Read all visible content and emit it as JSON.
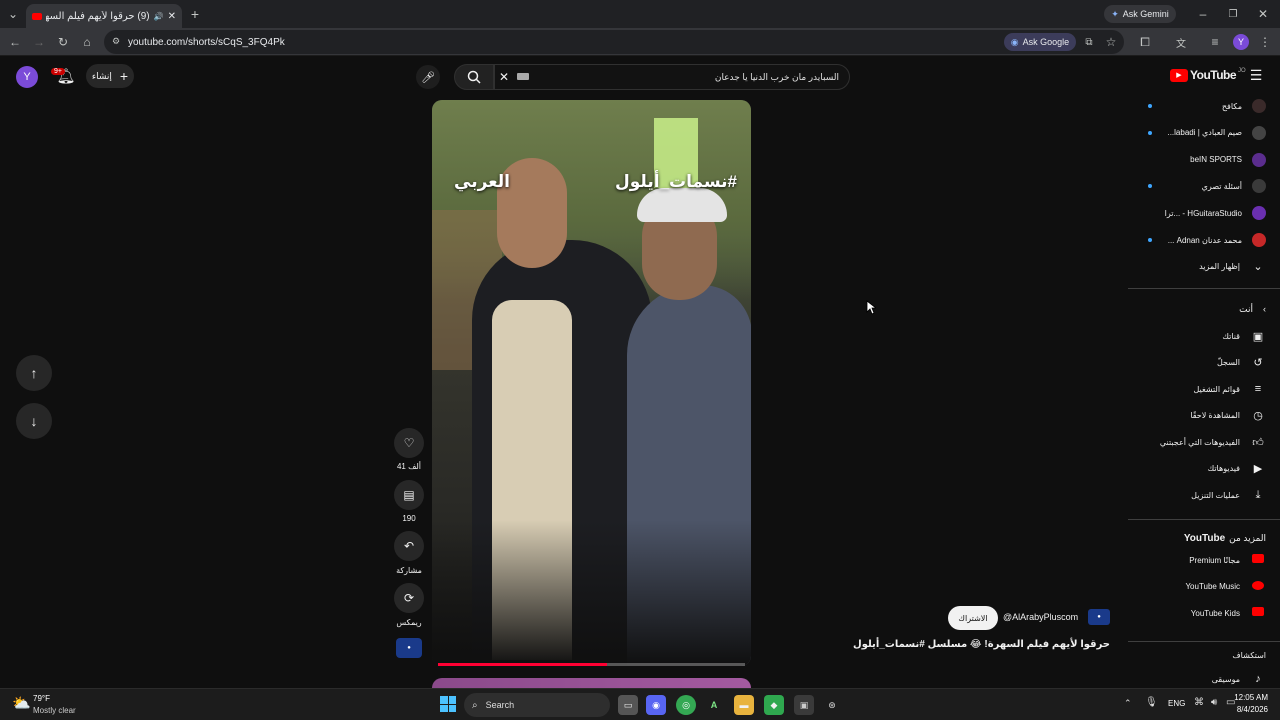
{
  "browser": {
    "tab_title": "(9) حرقوا لأيهم فيلم السهرة!",
    "ask_gemini": "Ask Gemini",
    "url": "youtube.com/shorts/sCqS_3FQ4Pk",
    "ask_google": "Ask Google",
    "profile_initial": "Y"
  },
  "header": {
    "logo_text": "YouTube",
    "logo_region": "JO",
    "search_value": "السبايدر مان خرب الدنيا يا جدعان",
    "create_label": "إنشاء",
    "notif_count": "9+",
    "avatar_initial": "Y"
  },
  "sidebar": {
    "subscriptions": [
      {
        "label": "مكافح",
        "dot": true,
        "color": "#3a2a2a"
      },
      {
        "label": "صيم العبادي | labadi...",
        "dot": true,
        "color": "#444"
      },
      {
        "label": "beIN SPORTS",
        "dot": false,
        "color": "#5b2d8e"
      },
      {
        "label": "أسئلة تصري",
        "dot": true,
        "color": "#3a3a3a"
      },
      {
        "label": "HGuitaraStudio - ...ترا",
        "dot": false,
        "color": "#6a2fb0"
      },
      {
        "label": "محمد عدنان Adnan ...",
        "dot": true,
        "color": "#c62828"
      }
    ],
    "show_more": "إظهار المزيد",
    "you_heading": "أنت",
    "you_items": [
      "قناتك",
      "السجلّ",
      "قوائم التشغيل",
      "المشاهدة لاحقًا",
      "الفيديوهات التي أعجبتني",
      "فيديوهاتك",
      "عمليات التنزيل"
    ],
    "more_from": "المزيد من",
    "more_from_brand": "YouTube",
    "more_items": [
      "Premium مجانًا",
      "YouTube Music",
      "YouTube Kids"
    ],
    "explore": "استكشاف",
    "music": "موسيقى"
  },
  "short": {
    "overlay_tag": "#نسمات_أيلول",
    "overlay_logo": "العربي",
    "likes": "41 ألف",
    "comments": "190",
    "share": "مشاركة",
    "remix": "ريمكس",
    "channel": "@AlArabyPluscom",
    "subscribe": "الاشتراك",
    "title": "حرقوا لأيهم فيلم السهرة! 😂 مسلسل #نسمات_أيلول",
    "progress": 0.55
  },
  "taskbar": {
    "temp": "79°F",
    "weather": "Mostly clear",
    "search": "Search",
    "lang": "ENG",
    "time": "12:05 AM",
    "date": "8/4/2026"
  }
}
